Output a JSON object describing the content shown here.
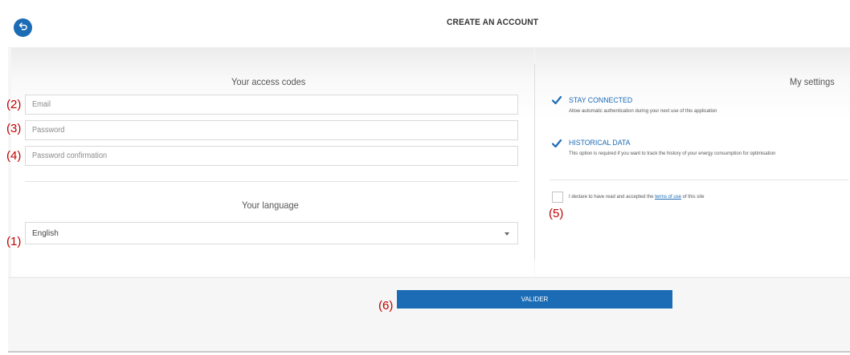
{
  "header": {
    "title": "CREATE AN ACCOUNT",
    "back_icon": "back-arrow-icon"
  },
  "access_codes": {
    "title": "Your access codes",
    "email_placeholder": "Email",
    "password_placeholder": "Password",
    "password_confirmation_placeholder": "Password confirmation"
  },
  "language": {
    "title": "Your language",
    "selected": "English"
  },
  "settings": {
    "title": "My settings",
    "stay_connected": {
      "label": "STAY CONNECTED",
      "description": "Allow automatic authentication during your next use of this application",
      "checked": true
    },
    "historical_data": {
      "label": "HISTORICAL DATA",
      "description": "This option is required if you want to track the history of your energy consumption for optimisation",
      "checked": true
    },
    "terms": {
      "prefix": "I declare to have read and accepted the",
      "link": "terms of use",
      "suffix": "of this site",
      "checked": false
    }
  },
  "validate_label": "VALIDER",
  "markers": {
    "language": "(1)",
    "email": "(2)",
    "password": "(3)",
    "password_confirmation": "(4)",
    "terms": "(5)",
    "validate": "(6)"
  },
  "colors": {
    "accent": "#1b6bb5",
    "marker": "#c00000"
  }
}
